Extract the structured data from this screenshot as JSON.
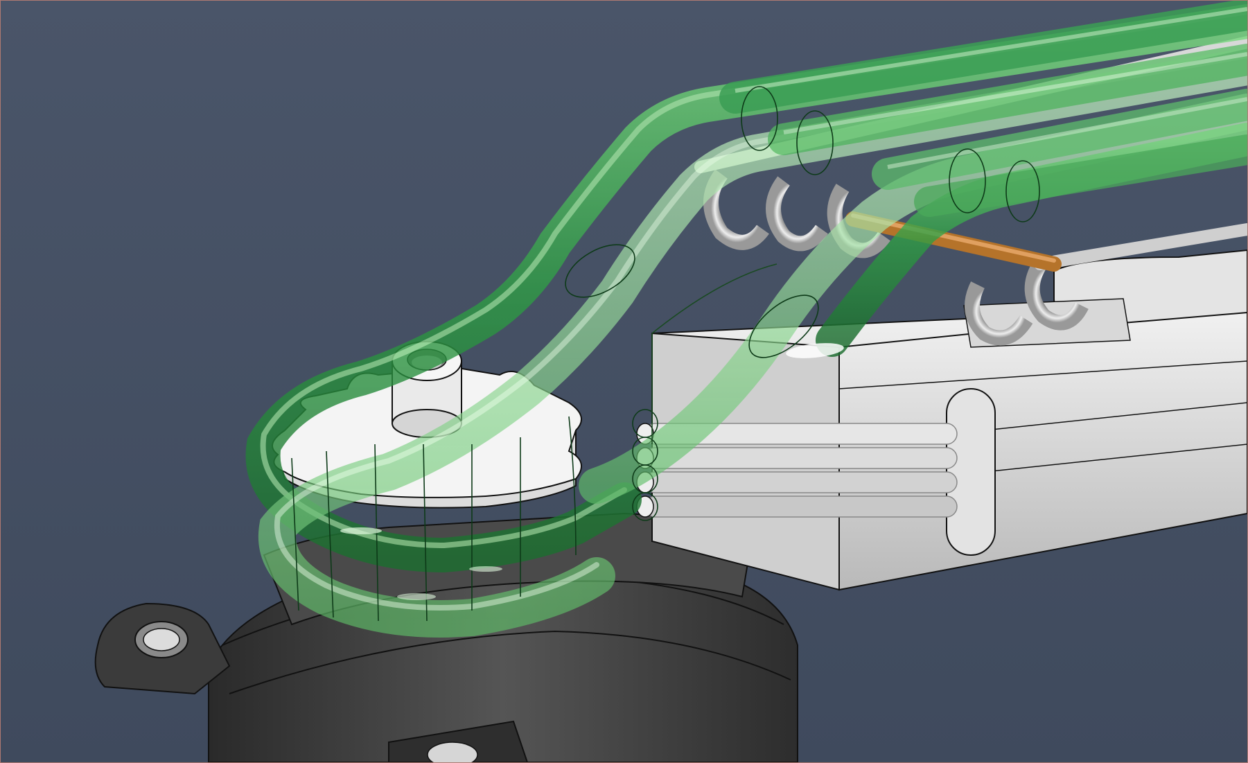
{
  "viewport": {
    "name": "cad-3d-viewport",
    "background": "#455064",
    "border_color": "#b07a72"
  },
  "model": {
    "tube_color": "#2ea84a",
    "tube_highlight": "#8fe08f",
    "part_light": "#d9d9d9",
    "part_dark": "#3a3a3a",
    "edge_color": "#111111",
    "copper": "#b5732a"
  }
}
